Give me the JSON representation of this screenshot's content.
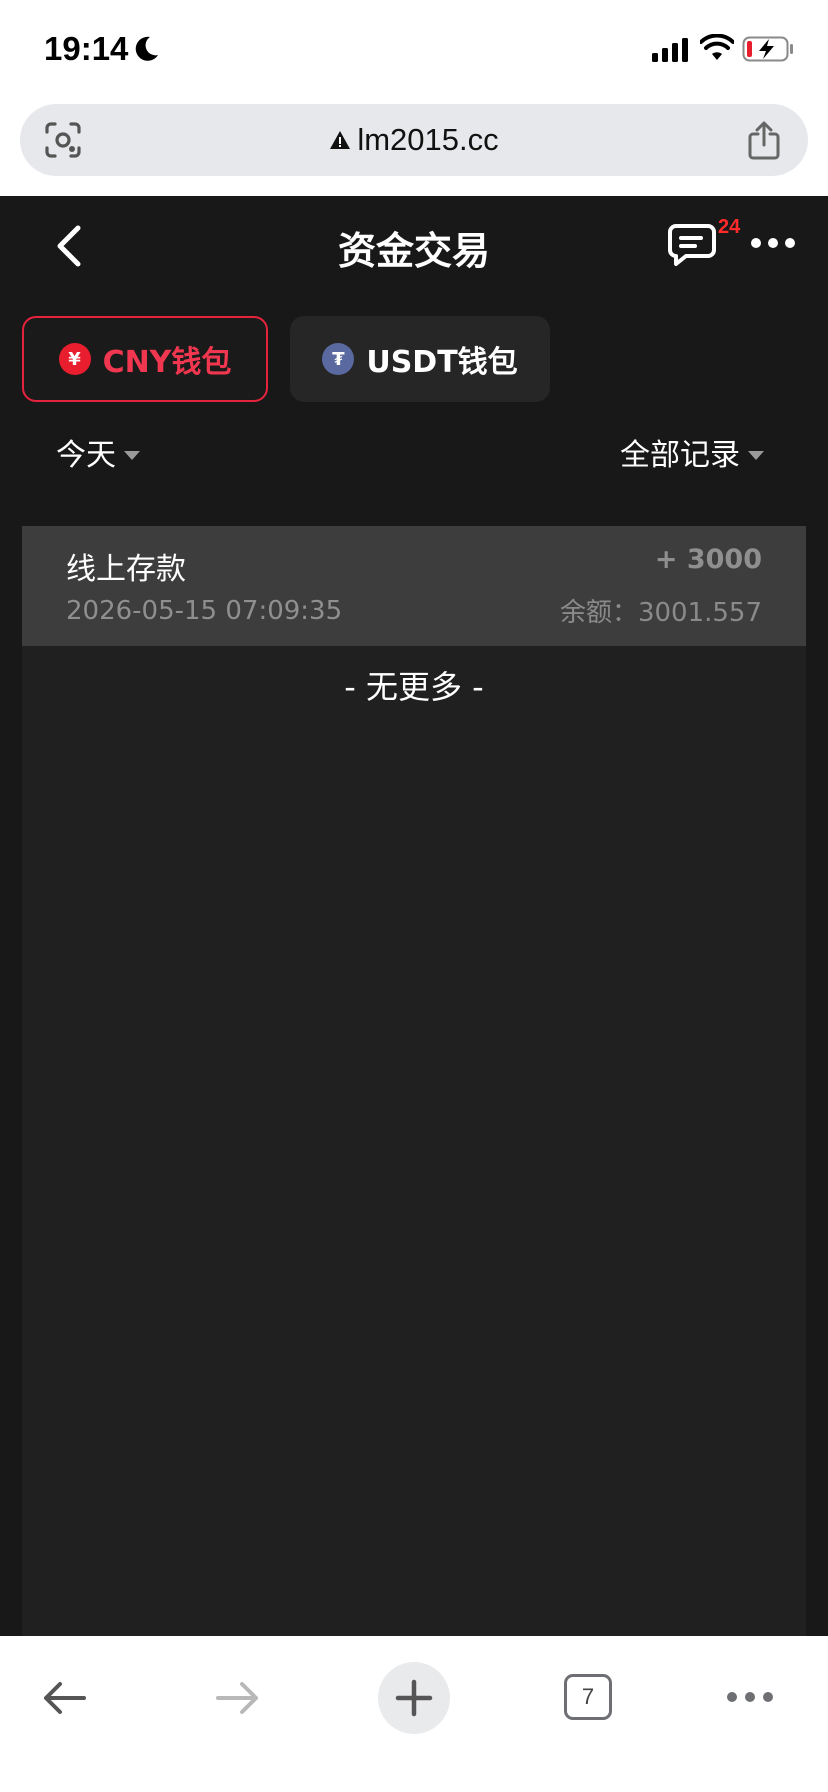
{
  "status_bar": {
    "time": "19:14"
  },
  "address_bar": {
    "url": "lm2015.cc"
  },
  "header": {
    "title": "资金交易",
    "message_badge": "24"
  },
  "wallet_tabs": [
    {
      "label": "CNY钱包",
      "coin_symbol": "¥",
      "active": true
    },
    {
      "label": "USDT钱包",
      "coin_symbol": "₮",
      "active": false
    }
  ],
  "filters": {
    "date": "今天",
    "record_type": "全部记录"
  },
  "records": [
    {
      "title": "线上存款",
      "time": "2026-05-15 07:09:35",
      "amount": "+ 3000",
      "balance": "余额：3001.557"
    }
  ],
  "list_footer": "- 无更多 -",
  "toolbar": {
    "tab_count": "7"
  },
  "colors": {
    "accent": "#e5233d",
    "app_background": "#181818",
    "panel_background": "#202020",
    "record_background": "#3d3d3d"
  }
}
